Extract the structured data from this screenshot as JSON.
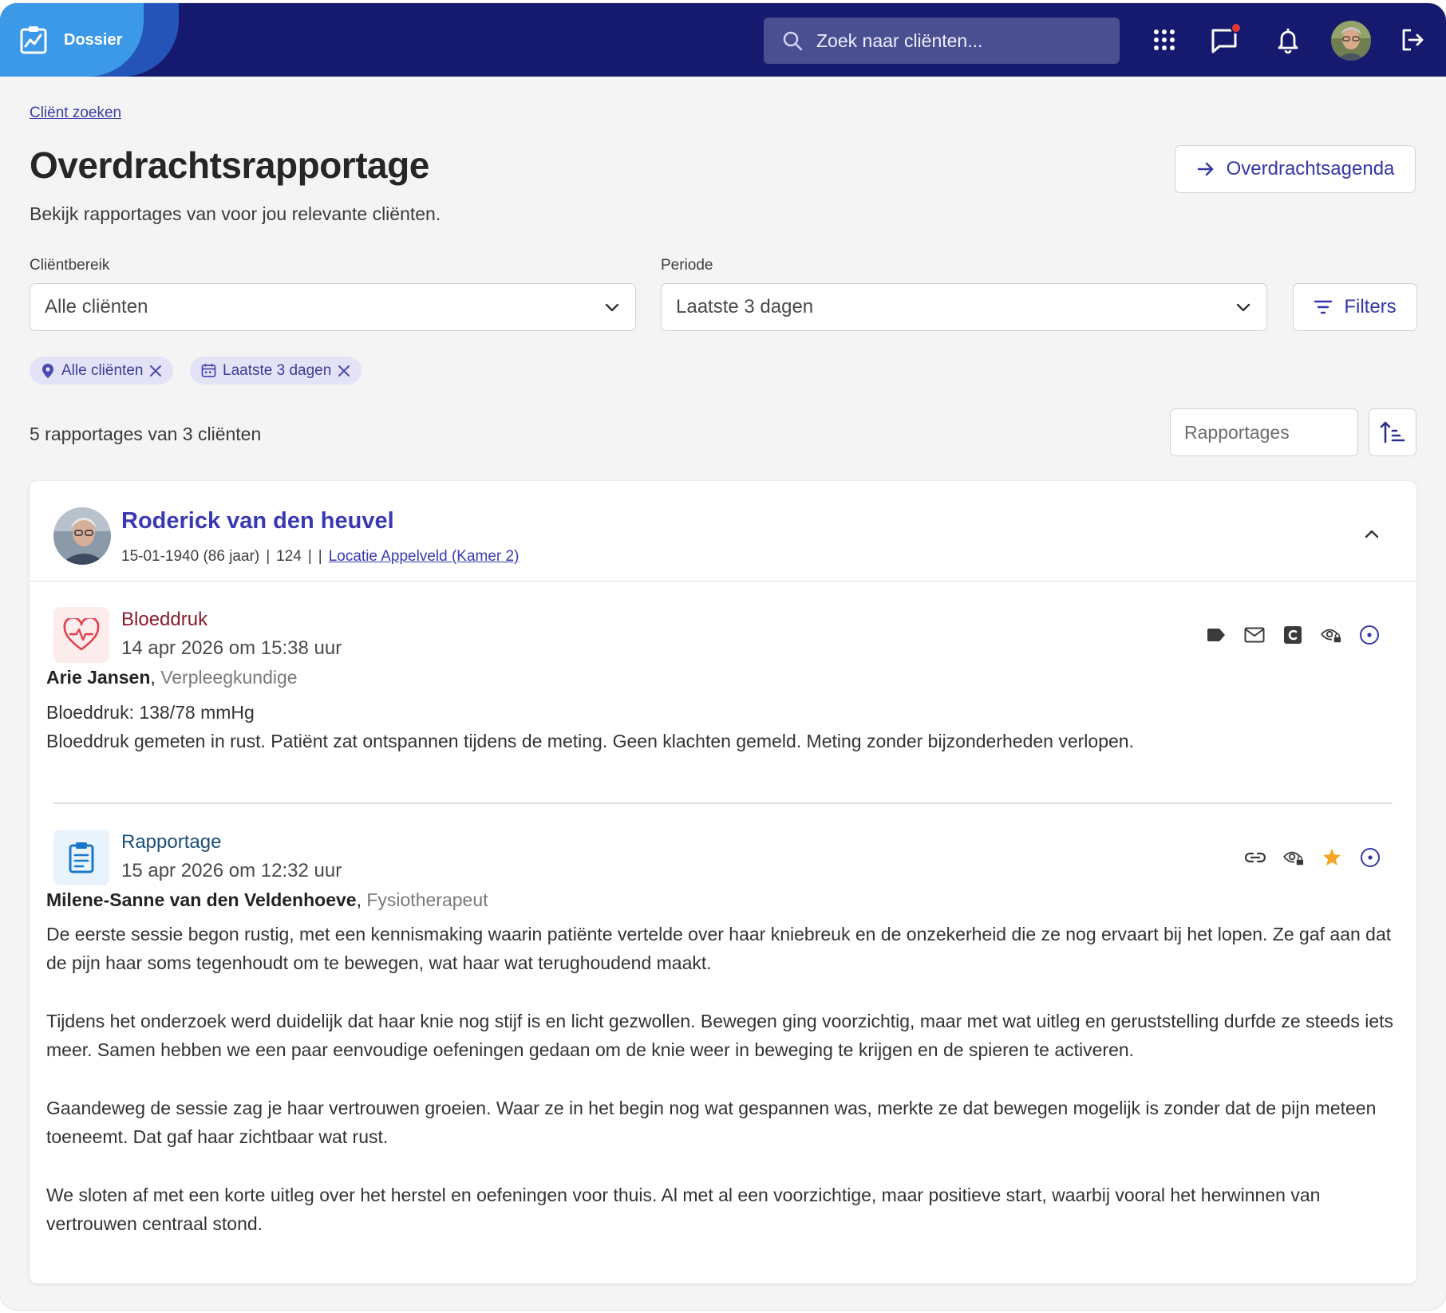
{
  "app": {
    "name": "Dossier"
  },
  "header": {
    "search_placeholder": "Zoek naar cliënten...",
    "icons": [
      "apps-grid-icon",
      "chat-icon",
      "bell-icon",
      "avatar",
      "logout-icon"
    ],
    "chat_has_notification": true
  },
  "breadcrumb": "Cliënt zoeken",
  "page": {
    "title": "Overdrachtsrapportage",
    "subtitle": "Bekijk rapportages van voor jou relevante cliënten.",
    "agenda_button": "Overdrachtsagenda"
  },
  "filters": {
    "clientrange_label": "Cliëntbereik",
    "clientrange_value": "Alle cliënten",
    "period_label": "Periode",
    "period_value": "Laatste 3 dagen",
    "filters_button": "Filters",
    "chips": [
      {
        "label": "Alle cliënten",
        "icon": "location-pin-icon"
      },
      {
        "label": "Laatste 3 dagen",
        "icon": "calendar-icon"
      }
    ]
  },
  "results": {
    "count_text": "5 rapportages van 3 cliënten",
    "sort_value": "Rapportages"
  },
  "client": {
    "name": "Roderick van den heuvel",
    "dob": "15-01-1940 (86 jaar)",
    "sep1": "|",
    "number": "124",
    "sep2": "|",
    "sep3": "|",
    "location": "Locatie Appelveld (Kamer 2)"
  },
  "reports": [
    {
      "type": "Bloeddruk",
      "date": "14 apr 2026 om 15:38 uur",
      "author": "Arie Jansen",
      "role": "Verpleegkundige",
      "line1": "Bloeddruk: 138/78 mmHg",
      "line2": "Bloeddruk gemeten in rust. Patiënt zat ontspannen tijdens de meting. Geen klachten gemeld. Meting zonder bijzonderheden verlopen.",
      "actions": [
        "tag-icon",
        "mail-icon",
        "c-badge-icon",
        "visibility-lock-icon",
        "more-circle-icon"
      ],
      "type_color": "#8b1a2b"
    },
    {
      "type": "Rapportage",
      "date": "15 apr 2026 om 12:32 uur",
      "author": "Milene-Sanne van den Veldenhoeve",
      "role": "Fysiotherapeut",
      "paragraphs": [
        "De eerste sessie begon rustig, met een kennismaking waarin patiënte vertelde over haar kniebreuk en de onzekerheid die ze nog ervaart bij het lopen. Ze gaf aan dat de pijn haar soms tegenhoudt om te bewegen, wat haar wat terughoudend maakt.",
        "Tijdens het onderzoek werd duidelijk dat haar knie nog stijf is en licht gezwollen. Bewegen ging voorzichtig, maar met wat uitleg en geruststelling durfde ze steeds iets meer. Samen hebben we een paar eenvoudige oefeningen gedaan om de knie weer in beweging te krijgen en de spieren te activeren.",
        "Gaandeweg de sessie zag je haar vertrouwen groeien. Waar ze in het begin nog wat gespannen was, merkte ze dat bewegen mogelijk is zonder dat de pijn meteen toeneemt. Dat gaf haar zichtbaar wat rust.",
        "We sloten af met een korte uitleg over het herstel en oefeningen voor thuis. Al met al een voorzichtige, maar positieve start, waarbij vooral het herwinnen van vertrouwen centraal stond."
      ],
      "actions": [
        "link-icon",
        "visibility-lock-icon",
        "star-icon",
        "more-circle-icon"
      ],
      "type_color": "#1d4f7a"
    }
  ],
  "colors": {
    "topbar": "#161a6e",
    "brand": "#3b99e8",
    "accent": "#3538a8",
    "star": "#f5a623",
    "notification": "#e53935"
  }
}
